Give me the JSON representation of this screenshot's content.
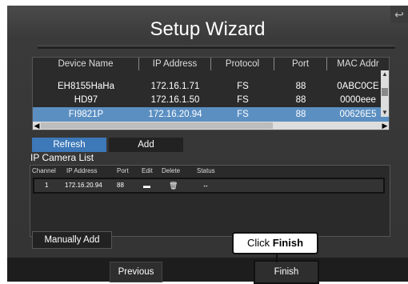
{
  "window": {
    "title": "Setup Wizard",
    "back_icon": "back-arrow-icon"
  },
  "device_table": {
    "columns": [
      "Device Name",
      "IP Address",
      "Protocol",
      "Port",
      "MAC Addr"
    ],
    "rows": [
      {
        "name": "EH8155HaHa",
        "ip": "172.16.1.71",
        "protocol": "FS",
        "port": "88",
        "mac": "0ABC0CE"
      },
      {
        "name": "HD97",
        "ip": "172.16.1.50",
        "protocol": "FS",
        "port": "88",
        "mac": "0000eee"
      },
      {
        "name": "FI9821P",
        "ip": "172.16.20.94",
        "protocol": "FS",
        "port": "88",
        "mac": "00626E5",
        "selected": true
      }
    ]
  },
  "buttons": {
    "refresh": "Refresh",
    "add": "Add",
    "manually_add": "Manually Add",
    "previous": "Previous",
    "finish": "Finish"
  },
  "camera_list": {
    "title": "IP Camera List",
    "columns": [
      "Channel",
      "IP Address",
      "Port",
      "Edit",
      "Delete",
      "Status"
    ],
    "rows": [
      {
        "channel": "1",
        "ip": "172.16.20.94",
        "port": "88"
      }
    ]
  },
  "callout": {
    "prefix": "Click ",
    "bold": "Finish"
  },
  "colors": {
    "selection": "#5b8fc2",
    "refresh_tab": "#3d78b8"
  }
}
